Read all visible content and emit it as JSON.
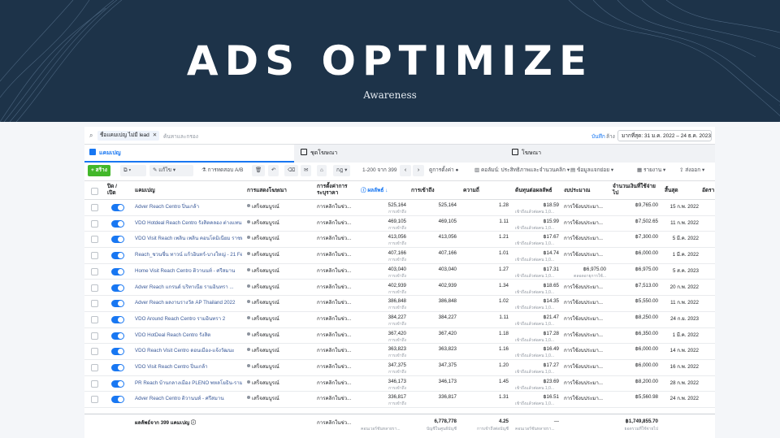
{
  "hero": {
    "title": "ADS OPTIMIZE",
    "subtitle": "Awareness"
  },
  "filterbar": {
    "chip_label": "ชื่อแคมเปญ ไม่มี lead",
    "placeholder": "ค้นหาและกรอง",
    "save_label": "บันทึก",
    "clear_label": "ล้าง",
    "date_range": "มากที่สุด: 31 ม.ค. 2022 – 24 ธ.ค. 2023"
  },
  "tabs": [
    {
      "label": "แคมเปญ"
    },
    {
      "label": "ชุดโฆษณา"
    },
    {
      "label": "โฆษณา"
    }
  ],
  "toolbar": {
    "create_label": "+ สร้าง",
    "edit_label": "แก้ไข",
    "ab_label": "การทดสอบ A/B",
    "range_label": "1-200 จาก 399",
    "type_label": "กฎ",
    "view_setup_label": "ดูการตั้งค่า",
    "columns_label": "คอลัมน์: ประสิทธิภาพและจำนวนคลิก",
    "breakdown_label": "ข้อมูลแจกย่อย",
    "reports_label": "รายงาน",
    "export_label": "ส่งออก"
  },
  "headers": {
    "onoff": "ปิด / เปิด",
    "campaign": "แคมเปญ",
    "delivery": "การแสดงโฆษณา",
    "bid": "การตั้งค่าการ ระบุราคา",
    "results": "ผลลัพธ์",
    "reach": "การเข้าถึง",
    "frequency": "ความถี่",
    "cpr": "ต้นทุนต่อผลลัพธ์",
    "budget": "งบประมาณ",
    "spent": "จำนวนเงินที่ใช้จ่ายไป",
    "ends": "สิ้นสุด",
    "more": "อัตรา"
  },
  "status_text": "เสร็จสมบูรณ์",
  "bid_text": "การคลิกในช่ว...",
  "result_sub": "การเข้าถึง",
  "cpr_sub": "เข้าถึงแล้วต่อคน 1,0...",
  "budget_text": "การใช้งบประมา...",
  "rows": [
    {
      "name": "Adver Reach Centro ปิ่นเกล้า",
      "results": "525,164",
      "reach": "525,164",
      "freq": "1.28",
      "cpr": "฿18.59",
      "spent": "฿9,765.00",
      "ends": "15 ก.พ. 2022"
    },
    {
      "name": "VDO Hotdeal Reach Centro รังสิตคลอง ต่างแทน",
      "results": "469,105",
      "reach": "469,105",
      "freq": "1.11",
      "cpr": "฿15.99",
      "spent": "฿7,502.65",
      "ends": "11 ก.พ. 2022"
    },
    {
      "name": "VDO Visit Reach เพลิน เพลิน คอนโดมิเนียม ราชพ...",
      "results": "413,056",
      "reach": "413,056",
      "freq": "1.21",
      "cpr": "฿17.67",
      "spent": "฿7,300.00",
      "ends": "5 มี.ค. 2022"
    },
    {
      "name": "Reach_ชวนชื่น ทาวน์ แก้วอินทร์-บางใหญ่ - 21 Feb...",
      "results": "407,166",
      "reach": "407,166",
      "freq": "1.01",
      "cpr": "฿14.74",
      "spent": "฿6,000.00",
      "ends": "1 มี.ค. 2022"
    },
    {
      "name": "Home Visit Reach Centro ติวานนท์ - ศรีสมาน",
      "results": "403,040",
      "reach": "403,040",
      "freq": "1.27",
      "cpr": "฿17.31",
      "budget_value": "฿6,975.00",
      "budget_sub": "ตลอดอายุการใช้...",
      "spent": "฿6,975.00",
      "ends": "5 ส.ค. 2023"
    },
    {
      "name": "Adver Reach แกรนด์ บริทาเนีย รามอินทรา ...",
      "results": "402,939",
      "reach": "402,939",
      "freq": "1.34",
      "cpr": "฿18.65",
      "spent": "฿7,513.00",
      "ends": "20 ก.พ. 2022"
    },
    {
      "name": "Adver Reach ผลงานรางวัล AP Thailand 2022",
      "results": "386,848",
      "reach": "386,848",
      "freq": "1.02",
      "cpr": "฿14.35",
      "spent": "฿5,550.00",
      "ends": "11 ก.พ. 2022"
    },
    {
      "name": "VDO Around Reach Centro รามอินทรา 2",
      "results": "384,227",
      "reach": "384,227",
      "freq": "1.11",
      "cpr": "฿21.47",
      "spent": "฿8,250.00",
      "ends": "24 ก.ย. 2023"
    },
    {
      "name": "VDO HotDeal Reach Centro รังสิต",
      "results": "367,420",
      "reach": "367,420",
      "freq": "1.18",
      "cpr": "฿17.28",
      "spent": "฿6,350.00",
      "ends": "1 มี.ค. 2022"
    },
    {
      "name": "VDO Reach Visit Centro ดอนเมือง-แจ้งวัฒนะ",
      "results": "363,823",
      "reach": "363,823",
      "freq": "1.16",
      "cpr": "฿16.49",
      "spent": "฿6,000.00",
      "ends": "14 ก.พ. 2022"
    },
    {
      "name": "VDO Visit Reach Centro ปิ่นเกล้า",
      "results": "347,375",
      "reach": "347,375",
      "freq": "1.20",
      "cpr": "฿17.27",
      "spent": "฿6,000.00",
      "ends": "16 ก.พ. 2022"
    },
    {
      "name": "PR Reach บ้านกลางเมือง PLENO พหลโยธิน-ราม...",
      "results": "346,173",
      "reach": "346,173",
      "freq": "1.45",
      "cpr": "฿23.69",
      "spent": "฿8,200.00",
      "ends": "28 ก.พ. 2022"
    },
    {
      "name": "Adver Reach Centro ติวานนท์ - ศรีสมาน",
      "results": "336,817",
      "reach": "336,817",
      "freq": "1.31",
      "cpr": "฿16.51",
      "spent": "฿5,560.98",
      "ends": "24 ก.พ. 2022"
    }
  ],
  "footer": {
    "label": "ผลลัพธ์จาก 399 แคมเปญ",
    "bid": "การคลิกในช่ว...",
    "results_sub": "คอนเวอร์ชันหลายรา...",
    "reach": "6,778,778",
    "reach_sub": "บัญชีในศูนย์บัญชี",
    "freq": "4.25",
    "freq_sub": "การเข้าถึงต่อบัญชี",
    "cpr": "—",
    "cpr_sub": "คอนเวอร์ชันหลายรา...",
    "spent": "฿1,749,855.70",
    "spent_sub": "ยอดรวมที่ใช้จ่ายไป"
  }
}
